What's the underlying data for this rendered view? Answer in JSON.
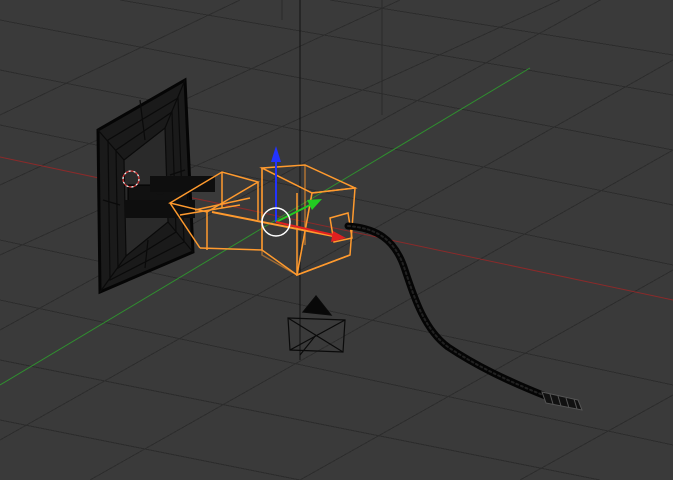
{
  "viewport": {
    "mode": "wireframe",
    "view": "user-perspective",
    "background_color": "#3a3a3a",
    "grid_color": "#2e2e2e",
    "x_axis_color": "#8a2a2a",
    "y_axis_color": "#2f8f2f",
    "selection_color": "#ff9a2e",
    "wire_color": "#0a0a0a",
    "gizmo": {
      "z_axis_color": "#2233ff",
      "y_axis_color": "#22cc22",
      "x_axis_color": "#e02020"
    },
    "objects": [
      {
        "name": "wall-plate",
        "selected": false
      },
      {
        "name": "plug-body",
        "selected": true
      },
      {
        "name": "cable",
        "selected": false
      },
      {
        "name": "connector",
        "selected": false
      },
      {
        "name": "camera",
        "selected": false
      },
      {
        "name": "lamp",
        "selected": false
      }
    ]
  }
}
